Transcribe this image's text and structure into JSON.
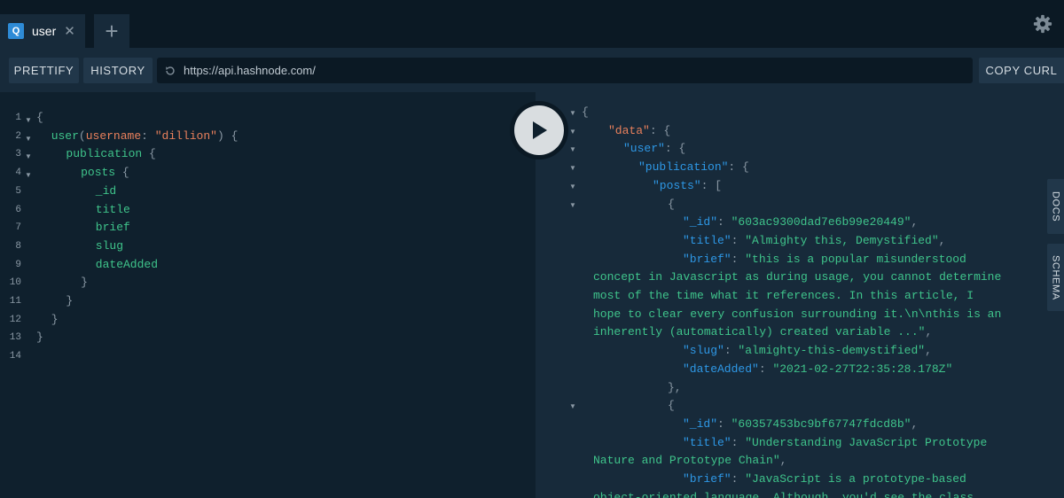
{
  "tabs": [
    {
      "badge": "Q",
      "label": "user",
      "close": "✕"
    }
  ],
  "new_tab_label": "+",
  "toolbar": {
    "prettify": "PRETTIFY",
    "history": "HISTORY",
    "url": "https://api.hashnode.com/",
    "copy_curl": "COPY CURL"
  },
  "run_button_icon": "play-icon",
  "side_tabs": {
    "docs": "DOCS",
    "schema": "SCHEMA"
  },
  "query": {
    "line_numbers": [
      "1",
      "2",
      "3",
      "4",
      "5",
      "6",
      "7",
      "8",
      "9",
      "10",
      "11",
      "12",
      "13",
      "14"
    ],
    "lines": [
      {
        "tokens": [
          {
            "t": "{",
            "c": "punc"
          }
        ]
      },
      {
        "tokens": [
          {
            "t": "user",
            "c": "field"
          },
          {
            "t": "(",
            "c": "punc"
          },
          {
            "t": "username",
            "c": "arg"
          },
          {
            "t": ": ",
            "c": "punc"
          },
          {
            "t": "\"dillion\"",
            "c": "str"
          },
          {
            "t": ") {",
            "c": "punc"
          }
        ]
      },
      {
        "tokens": [
          {
            "t": "publication",
            "c": "field"
          },
          {
            "t": " {",
            "c": "punc"
          }
        ]
      },
      {
        "tokens": [
          {
            "t": "posts",
            "c": "field"
          },
          {
            "t": " {",
            "c": "punc"
          }
        ]
      },
      {
        "tokens": [
          {
            "t": "_id",
            "c": "field"
          }
        ]
      },
      {
        "tokens": [
          {
            "t": "title",
            "c": "field"
          }
        ]
      },
      {
        "tokens": [
          {
            "t": "brief",
            "c": "field"
          }
        ]
      },
      {
        "tokens": [
          {
            "t": "slug",
            "c": "field"
          }
        ]
      },
      {
        "tokens": [
          {
            "t": "dateAdded",
            "c": "field"
          }
        ]
      },
      {
        "tokens": [
          {
            "t": "}",
            "c": "punc"
          }
        ]
      },
      {
        "tokens": [
          {
            "t": "}",
            "c": "punc"
          }
        ]
      },
      {
        "tokens": [
          {
            "t": "}",
            "c": "punc"
          }
        ]
      },
      {
        "tokens": [
          {
            "t": "}",
            "c": "punc"
          }
        ]
      },
      {
        "tokens": []
      }
    ]
  },
  "result": {
    "lines": [
      {
        "tokens": [
          {
            "t": "{",
            "c": "punc"
          }
        ]
      },
      {
        "tokens": [
          {
            "t": "\"data\"",
            "c": "data"
          },
          {
            "t": ": {",
            "c": "punc"
          }
        ]
      },
      {
        "tokens": [
          {
            "t": "\"user\"",
            "c": "key"
          },
          {
            "t": ": {",
            "c": "punc"
          }
        ]
      },
      {
        "tokens": [
          {
            "t": "\"publication\"",
            "c": "key"
          },
          {
            "t": ": {",
            "c": "punc"
          }
        ]
      },
      {
        "tokens": [
          {
            "t": "\"posts\"",
            "c": "key"
          },
          {
            "t": ": [",
            "c": "punc"
          }
        ]
      },
      {
        "tokens": [
          {
            "t": "{",
            "c": "punc"
          }
        ]
      },
      {
        "tokens": [
          {
            "t": "\"_id\"",
            "c": "key"
          },
          {
            "t": ": ",
            "c": "punc"
          },
          {
            "t": "\"603ac9300dad7e6b99e20449\"",
            "c": "val"
          },
          {
            "t": ",",
            "c": "punc"
          }
        ]
      },
      {
        "tokens": [
          {
            "t": "\"title\"",
            "c": "key"
          },
          {
            "t": ": ",
            "c": "punc"
          },
          {
            "t": "\"Almighty this, Demystified\"",
            "c": "val"
          },
          {
            "t": ",",
            "c": "punc"
          }
        ]
      },
      {
        "tokens": [
          {
            "t": "\"brief\"",
            "c": "key"
          },
          {
            "t": ": ",
            "c": "punc"
          },
          {
            "t": "\"this is a popular misunderstood",
            "c": "val"
          }
        ]
      },
      {
        "tokens": [
          {
            "t": "concept in Javascript as during usage, you cannot determine",
            "c": "val"
          }
        ]
      },
      {
        "tokens": [
          {
            "t": "most of the time what it references. In this article, I",
            "c": "val"
          }
        ]
      },
      {
        "tokens": [
          {
            "t": "hope to clear every confusion surrounding it.\\n\\nthis is an",
            "c": "val"
          }
        ]
      },
      {
        "tokens": [
          {
            "t": "inherently (automatically) created variable ...\"",
            "c": "val"
          },
          {
            "t": ",",
            "c": "punc"
          }
        ]
      },
      {
        "tokens": [
          {
            "t": "\"slug\"",
            "c": "key"
          },
          {
            "t": ": ",
            "c": "punc"
          },
          {
            "t": "\"almighty-this-demystified\"",
            "c": "val"
          },
          {
            "t": ",",
            "c": "punc"
          }
        ]
      },
      {
        "tokens": [
          {
            "t": "\"dateAdded\"",
            "c": "key"
          },
          {
            "t": ": ",
            "c": "punc"
          },
          {
            "t": "\"2021-02-27T22:35:28.178Z\"",
            "c": "val"
          }
        ]
      },
      {
        "tokens": [
          {
            "t": "},",
            "c": "punc"
          }
        ]
      },
      {
        "tokens": [
          {
            "t": "{",
            "c": "punc"
          }
        ]
      },
      {
        "tokens": [
          {
            "t": "\"_id\"",
            "c": "key"
          },
          {
            "t": ": ",
            "c": "punc"
          },
          {
            "t": "\"60357453bc9bf67747fdcd8b\"",
            "c": "val"
          },
          {
            "t": ",",
            "c": "punc"
          }
        ]
      },
      {
        "tokens": [
          {
            "t": "\"title\"",
            "c": "key"
          },
          {
            "t": ": ",
            "c": "punc"
          },
          {
            "t": "\"Understanding JavaScript Prototype",
            "c": "val"
          }
        ]
      },
      {
        "tokens": [
          {
            "t": "Nature and Prototype Chain\"",
            "c": "val"
          },
          {
            "t": ",",
            "c": "punc"
          }
        ]
      },
      {
        "tokens": [
          {
            "t": "\"brief\"",
            "c": "key"
          },
          {
            "t": ": ",
            "c": "punc"
          },
          {
            "t": "\"JavaScript is a prototype-based",
            "c": "val"
          }
        ]
      },
      {
        "tokens": [
          {
            "t": "object-oriented language. Although, you'd see the class",
            "c": "val"
          }
        ]
      }
    ]
  },
  "colors": {
    "accent": "#2e8bd6",
    "field": "#3fc48b",
    "string": "#e9805c",
    "key": "#2e98e6"
  }
}
